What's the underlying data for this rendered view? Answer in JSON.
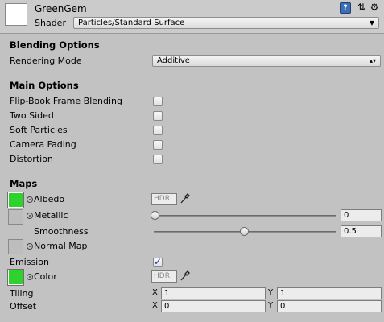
{
  "header": {
    "material_name": "GreenGem",
    "shader_label": "Shader",
    "shader_value": "Particles/Standard Surface",
    "help_icon_text": "?",
    "preset_icon_text": "⇅",
    "settings_icon_text": "⚙"
  },
  "blending": {
    "title": "Blending Options",
    "rendering_mode_label": "Rendering Mode",
    "rendering_mode_value": "Additive"
  },
  "main_options": {
    "title": "Main Options",
    "items": [
      {
        "label": "Flip-Book Frame Blending",
        "checked": false
      },
      {
        "label": "Two Sided",
        "checked": false
      },
      {
        "label": "Soft Particles",
        "checked": false
      },
      {
        "label": "Camera Fading",
        "checked": false
      },
      {
        "label": "Distortion",
        "checked": false
      }
    ]
  },
  "maps": {
    "title": "Maps",
    "albedo_label": "Albedo",
    "albedo_color": "#2fd12f",
    "hdr_text": "HDR",
    "metallic_label": "Metallic",
    "metallic_value": "0",
    "smoothness_label": "Smoothness",
    "smoothness_value": "0.5",
    "normal_map_label": "Normal Map"
  },
  "emission": {
    "label": "Emission",
    "checked": true,
    "color_label": "Color",
    "color": "#2fd12f",
    "hdr_text": "HDR"
  },
  "tiling": {
    "label": "Tiling",
    "x_label": "X",
    "x_value": "1",
    "y_label": "Y",
    "y_value": "1"
  },
  "offset": {
    "label": "Offset",
    "x_label": "X",
    "x_value": "0",
    "y_label": "Y",
    "y_value": "0"
  }
}
